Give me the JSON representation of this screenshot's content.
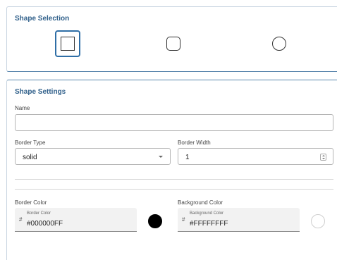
{
  "shape_selection": {
    "title": "Shape Selection",
    "shapes": [
      {
        "icon": "square-icon",
        "selected": true
      },
      {
        "icon": "rounded-square-icon",
        "selected": false
      },
      {
        "icon": "circle-icon",
        "selected": false
      }
    ]
  },
  "shape_settings": {
    "title": "Shape Settings",
    "name": {
      "label": "Name",
      "value": ""
    },
    "border_type": {
      "label": "Border Type",
      "value": "solid"
    },
    "border_width": {
      "label": "Border Width",
      "value": "1"
    },
    "border_color": {
      "label": "Border Color",
      "field_label": "Border Color",
      "prefix": "#",
      "value": "#000000FF",
      "swatch": "#000000"
    },
    "background_color": {
      "label": "Background Color",
      "field_label": "Background Color",
      "prefix": "#",
      "value": "#FFFFFFFF",
      "swatch": "#FFFFFF"
    }
  }
}
